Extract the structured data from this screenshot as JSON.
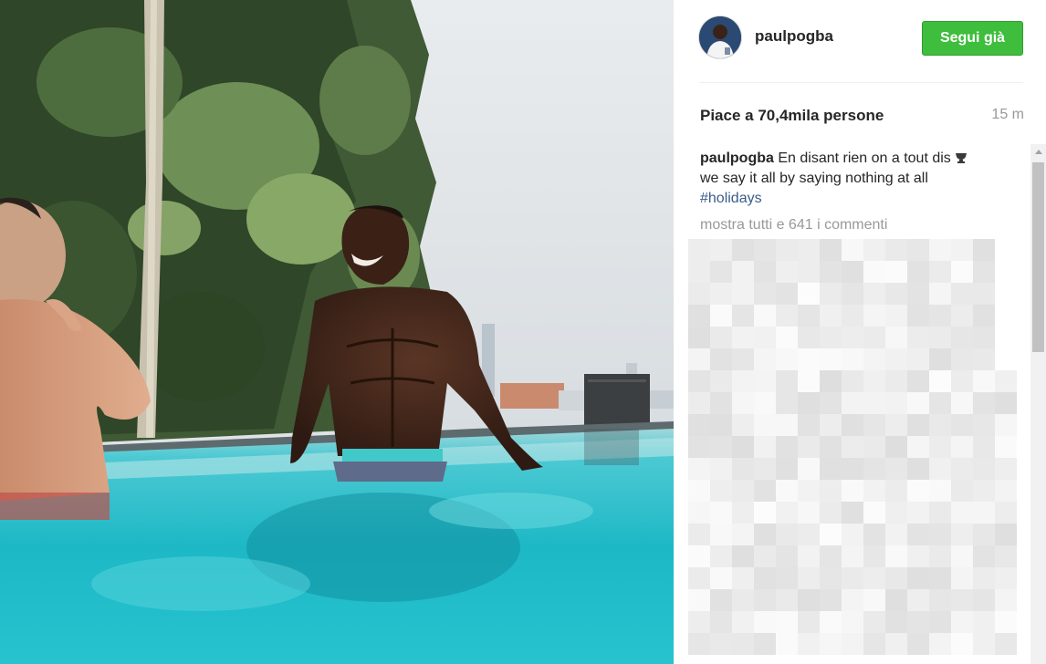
{
  "post": {
    "username": "paulpogba",
    "follow_label": "Segui già",
    "likes_text": "Piace a 70,4mila persone",
    "time_ago": "15 m",
    "caption": {
      "username": "paulpogba",
      "line1": "En disant rien on a tout dis",
      "line2": "we say it all by saying nothing at all",
      "hashtag": "#holidays"
    },
    "view_all_comments": "mostra tutti e 641 i commenti"
  },
  "icons": {
    "caption_emoji": "trophy-icon",
    "avatar": "profile-avatar"
  },
  "colors": {
    "follow_button": "#3fbd3d",
    "hashtag": "#3b5c8a",
    "muted_text": "#999999",
    "pool_water": "#2fc6d0"
  }
}
